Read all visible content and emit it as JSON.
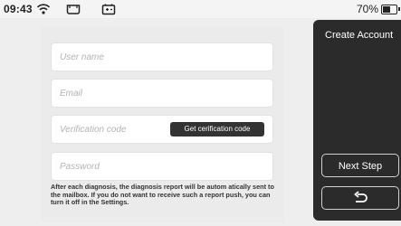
{
  "status_bar": {
    "time": "09:43",
    "battery_percent_label": "70%",
    "battery_level": 0.7,
    "icons": [
      "wifi-icon",
      "sd-card-icon",
      "battery-status-icon",
      "battery-icon"
    ]
  },
  "form": {
    "username_placeholder": "User name",
    "email_placeholder": "Email",
    "verification_placeholder": "Verification code",
    "verification_button": "Get cerification code",
    "password_placeholder": "Password",
    "note": "After each diagnosis, the diagnosis report will be autom atically sent to the mailbox. If you do not want to receive such a report push, you can turn it off in the Settings."
  },
  "panel": {
    "title": "Create Account",
    "next_button": "Next Step",
    "back_icon": "back-arrow-icon"
  },
  "colors": {
    "panel_bg": "#2b2b2b",
    "button_dark": "#333333",
    "page_bg": "#eeeeee"
  }
}
